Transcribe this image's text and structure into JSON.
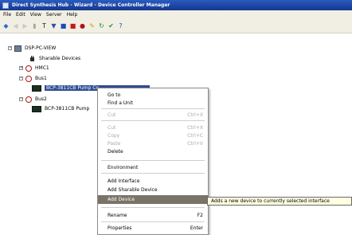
{
  "window": {
    "title": "Direct Synthesis Hub - Wizard - Device Controller Manager"
  },
  "menu": [
    "File",
    "Edit",
    "View",
    "Server",
    "Help"
  ],
  "toolbar_icons": [
    "logo-icon",
    "back-icon",
    "forward-icon",
    "up-icon",
    "properties-icon",
    "filter-icon",
    "stop-icon",
    "record-icon",
    "settings-icon",
    "tools-icon",
    "refresh-icon",
    "ok-icon",
    "help-icon"
  ],
  "tree": {
    "root": "DSP-PC-VIEW",
    "shared_devices": "Sharable Devices",
    "node1": "HMC1",
    "node2": "Bus1",
    "node2_child": "BCP-3811CB Pump Co",
    "node3": "Bus2",
    "node3_child": "BCP-3811CB Pump"
  },
  "context_menu": {
    "items": [
      {
        "label": "Go to",
        "shortcut": ""
      },
      {
        "label": "Find a Unit",
        "shortcut": ""
      },
      {
        "label": "Cut",
        "shortcut": "Ctrl+X"
      },
      {
        "label": "Cut",
        "shortcut": "Ctrl+X"
      },
      {
        "label": "Copy",
        "shortcut": "Ctrl+C"
      },
      {
        "label": "Paste",
        "shortcut": "Ctrl+V"
      },
      {
        "label": "Delete",
        "shortcut": ""
      },
      {
        "label": "Environment",
        "shortcut": ""
      },
      {
        "label": "Add Interface",
        "shortcut": ""
      },
      {
        "label": "Add Sharable Device",
        "shortcut": ""
      },
      {
        "label": "Add Device",
        "shortcut": ""
      },
      {
        "label": "Rename",
        "shortcut": "F2"
      },
      {
        "label": "Properties",
        "shortcut": "Enter"
      }
    ]
  },
  "tooltip": "Adds a new device to currently selected interface",
  "colors": {
    "titlebar": "#1d46a4",
    "selection": "#2f4d92",
    "menu_highlight": "#7a7368",
    "red_node": "#b01414",
    "tooltip_bg": "#ffffe1"
  }
}
